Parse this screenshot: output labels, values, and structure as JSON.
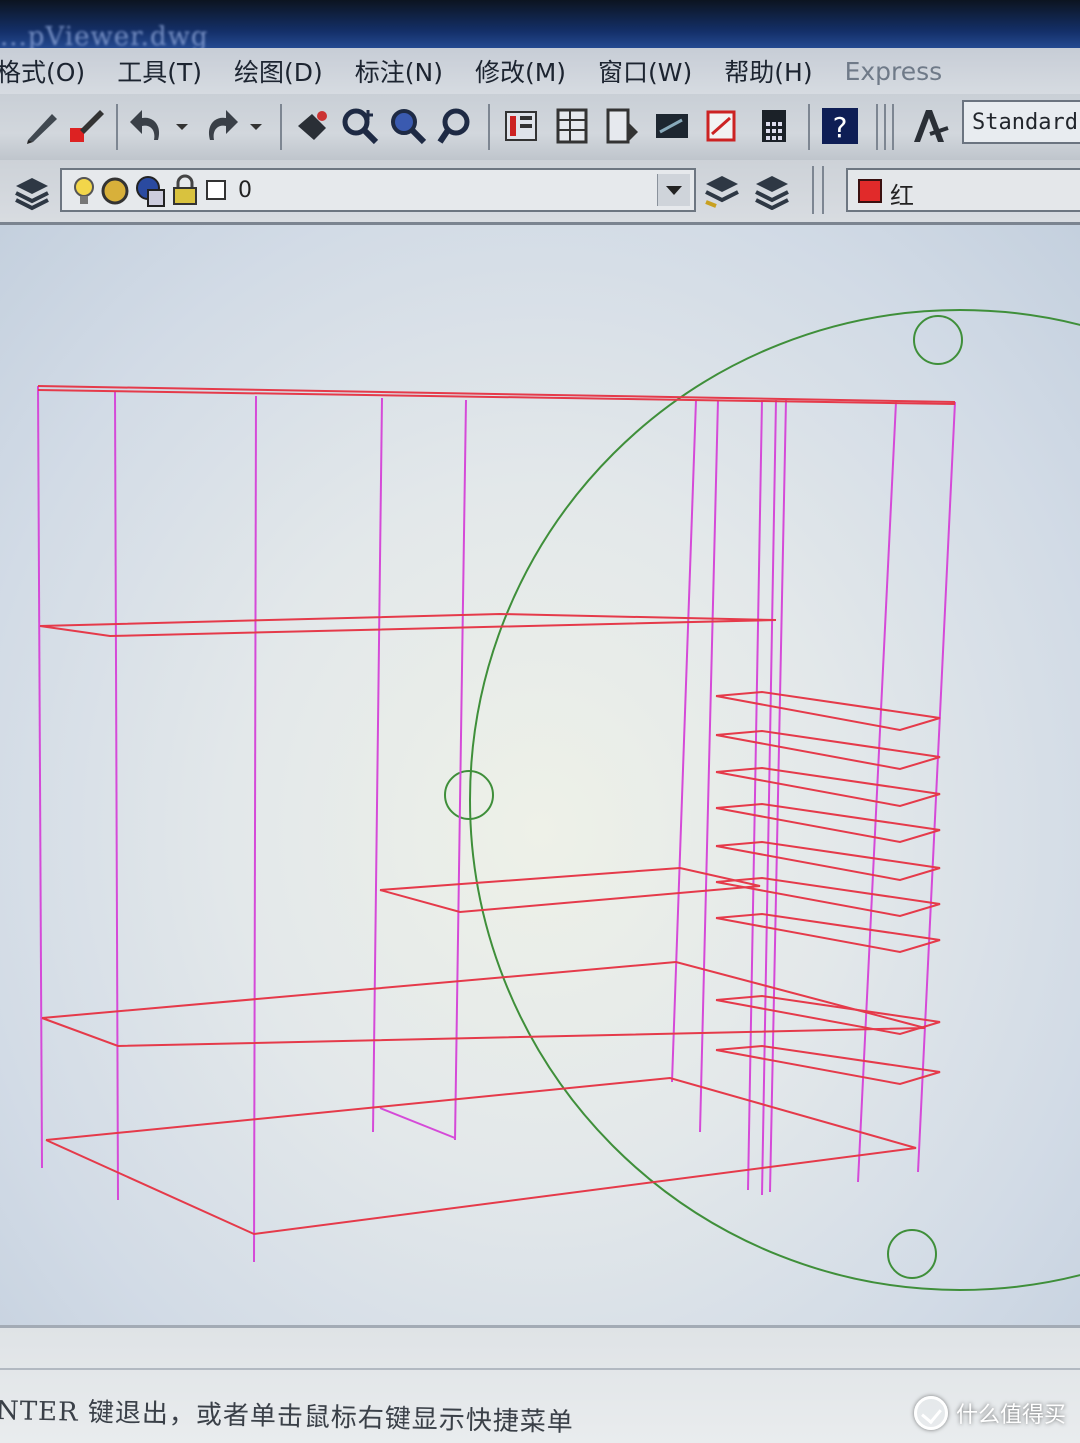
{
  "window": {
    "title": "...pViewer.dwg"
  },
  "menubar": {
    "items": [
      {
        "label": "格式(O)"
      },
      {
        "label": "工具(T)"
      },
      {
        "label": "绘图(D)"
      },
      {
        "label": "标注(N)"
      },
      {
        "label": "修改(M)"
      },
      {
        "label": "窗口(W)"
      },
      {
        "label": "帮助(H)"
      },
      {
        "label": "Express"
      }
    ]
  },
  "toolbar": {
    "text_style": "Standard",
    "icons": [
      "pencil-icon",
      "match-properties-icon",
      "undo-icon",
      "redo-icon",
      "pan-icon",
      "zoom-realtime-icon",
      "zoom-window-icon",
      "zoom-previous-icon",
      "properties-icon",
      "design-center-icon",
      "tool-palettes-icon",
      "sheet-set-icon",
      "markup-icon",
      "quickcalc-icon",
      "help-icon",
      "text-style-icon"
    ]
  },
  "layers": {
    "current_layer": "0",
    "current_color": "红",
    "colors": {
      "swatch": "#e12a2a"
    }
  },
  "drawing": {
    "colors": {
      "frame": "#e53a4a",
      "posts": "#d54ad8",
      "orbit": "#3f8f3a"
    }
  },
  "command": {
    "prompt": "NTER 键退出，或者单击鼠标右键显示快捷菜单"
  },
  "watermark": {
    "text": "什么值得买"
  }
}
